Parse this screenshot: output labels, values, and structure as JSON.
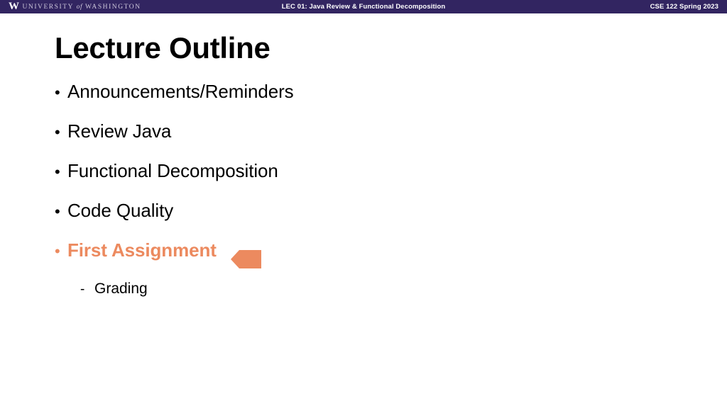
{
  "banner": {
    "logo_mark": "W",
    "logo_pre": "UNIVERSITY",
    "logo_of": "of",
    "logo_post": "WASHINGTON",
    "lecture_title": "LEC 01: Java Review & Functional Decomposition",
    "course_term": "CSE 122 Spring 2023",
    "bar_color": "#322561"
  },
  "slide": {
    "title": "Lecture Outline",
    "accent_color": "#ec8a5f",
    "bullets": [
      {
        "marker": "•",
        "label": "Announcements/Reminders",
        "highlighted": false
      },
      {
        "marker": "•",
        "label": "Review Java",
        "highlighted": false
      },
      {
        "marker": "•",
        "label": "Functional Decomposition",
        "highlighted": false
      },
      {
        "marker": "•",
        "label": "Code Quality",
        "highlighted": false
      },
      {
        "marker": "•",
        "label": "First Assignment",
        "highlighted": true
      }
    ],
    "sub_bullets": [
      {
        "marker": "-",
        "label": "Grading"
      }
    ]
  }
}
